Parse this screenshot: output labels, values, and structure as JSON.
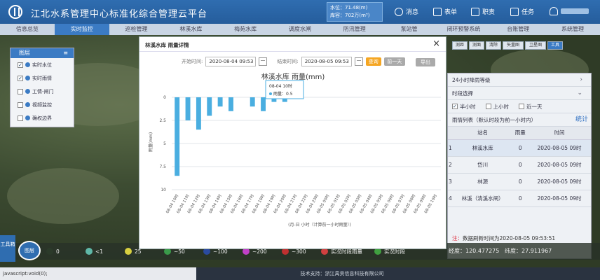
{
  "app": {
    "title": "江北水系管理中心标准化综合管理云平台"
  },
  "header": {
    "levels": [
      {
        "label": "水位：",
        "value": "71.48(m)"
      },
      {
        "label": "库容：",
        "value": "702万(m³)"
      }
    ],
    "buttons": [
      {
        "label": "消息",
        "icon": "refresh-icon"
      },
      {
        "label": "表单",
        "icon": "form-icon"
      },
      {
        "label": "职责",
        "icon": "duty-icon"
      },
      {
        "label": "任务",
        "icon": "task-icon"
      }
    ]
  },
  "nav": {
    "tabs": [
      "信息总览",
      "实时监控",
      "巡检管理",
      "林溪水库",
      "梅苑水库",
      "调度水闸",
      "防汛管理",
      "泵站管",
      "闭环预警系统",
      "台账管理",
      "系统管理"
    ],
    "active": 1
  },
  "layer_panel": {
    "title": "图层",
    "items": [
      {
        "label": "实时水位",
        "checked": true
      },
      {
        "label": "实时雨情",
        "checked": true
      },
      {
        "label": "工情-闸门",
        "checked": false
      },
      {
        "label": "视频监控",
        "checked": false
      },
      {
        "label": "确权边界",
        "checked": false
      }
    ]
  },
  "map_toolbar": [
    "测距",
    "测面",
    "清除",
    "矢量图",
    "卫星图",
    "工具"
  ],
  "right_panel": {
    "row1": "24小时降雨等级",
    "row2": "时段选择",
    "options": [
      {
        "label": "半小时",
        "checked": true
      },
      {
        "label": "上小时",
        "checked": false
      },
      {
        "label": "近一天",
        "checked": false
      }
    ],
    "list_title": "雨情列表（默认时段为前一小时内）",
    "list_action": "统计",
    "columns": [
      "站名",
      "雨量",
      "时间"
    ],
    "rows": [
      {
        "no": "1",
        "name": "林溪水库",
        "rain": "0",
        "time": "2020-08-05 09时"
      },
      {
        "no": "2",
        "name": "岱川",
        "rain": "0",
        "time": "2020-08-05 09时"
      },
      {
        "no": "3",
        "name": "林源",
        "rain": "0",
        "time": "2020-08-05 09时"
      },
      {
        "no": "4",
        "name": "林溪（清溪水闸）",
        "rain": "0",
        "time": "2020-08-05 09时"
      }
    ],
    "note_prefix": "注：",
    "note": "数据刷新时间为2020-08-05 09:53:51"
  },
  "legend": [
    {
      "label": "0",
      "color": "#2b3a2a"
    },
    {
      "label": "<1",
      "color": "#5fb8a8"
    },
    {
      "label": "25",
      "color": "#d8d040"
    },
    {
      "label": "~50",
      "color": "#3a9a4a"
    },
    {
      "label": "~100",
      "color": "#2a4aa0"
    },
    {
      "label": "~200",
      "color": "#c040c8"
    },
    {
      "label": "~300",
      "color": "#c03030"
    },
    {
      "label": "实况时段雨量",
      "color": "#d04040"
    },
    {
      "label": "实况时段",
      "color": "#40a040"
    }
  ],
  "coords": {
    "lon_label": "经度：",
    "lon": "120.477275",
    "lat_label": "纬度：",
    "lat": "27.911967"
  },
  "side_badge": "工具箱",
  "zoom_badge": "图层",
  "status": {
    "left": "javascript:void(0);",
    "footer": "技术支持：浙江禹贡信息科技有限公司"
  },
  "dialog": {
    "title": "林溪水库 雨量详情",
    "start_label": "开始时间:",
    "start_value": "2020-08-04 09:53",
    "end_label": "结束时间:",
    "end_value": "2020-08-05 09:53",
    "query_btn": "查询",
    "prev_btn": "前一天",
    "export_btn": "导出"
  },
  "tooltip": {
    "time": "08-04 10时",
    "label": "雨量：",
    "value": "0.5"
  },
  "chart_data": {
    "type": "bar",
    "title": "林溪水库 雨量(mm)",
    "ylabel": "雨量(mm)",
    "xlabel": "(月-日 小时（计算前一小时雨量）)",
    "ylim": [
      0,
      10
    ],
    "y_inverted": true,
    "yticks": [
      0,
      2.5,
      5,
      7.5,
      10
    ],
    "color": "#4aaee0",
    "categories": [
      "08-04 10时",
      "08-04 11时",
      "08-04 12时",
      "08-04 13时",
      "08-04 14时",
      "08-04 15时",
      "08-04 16时",
      "08-04 17时",
      "08-04 18时",
      "08-04 19时",
      "08-04 20时",
      "08-04 21时",
      "08-04 22时",
      "08-04 23时",
      "08-05 00时",
      "08-05 01时",
      "08-05 02时",
      "08-05 03时",
      "08-05 04时",
      "08-05 05时",
      "08-05 06时",
      "08-05 07时",
      "08-05 08时",
      "08-05 09时",
      "08-05 10时"
    ],
    "values": [
      8.5,
      2.5,
      3.5,
      2.0,
      1.0,
      1.5,
      0,
      1.0,
      1.5,
      0.5,
      0.5,
      0,
      0,
      0,
      0,
      0,
      0,
      0,
      0,
      0,
      0,
      0,
      0,
      0,
      0
    ]
  }
}
